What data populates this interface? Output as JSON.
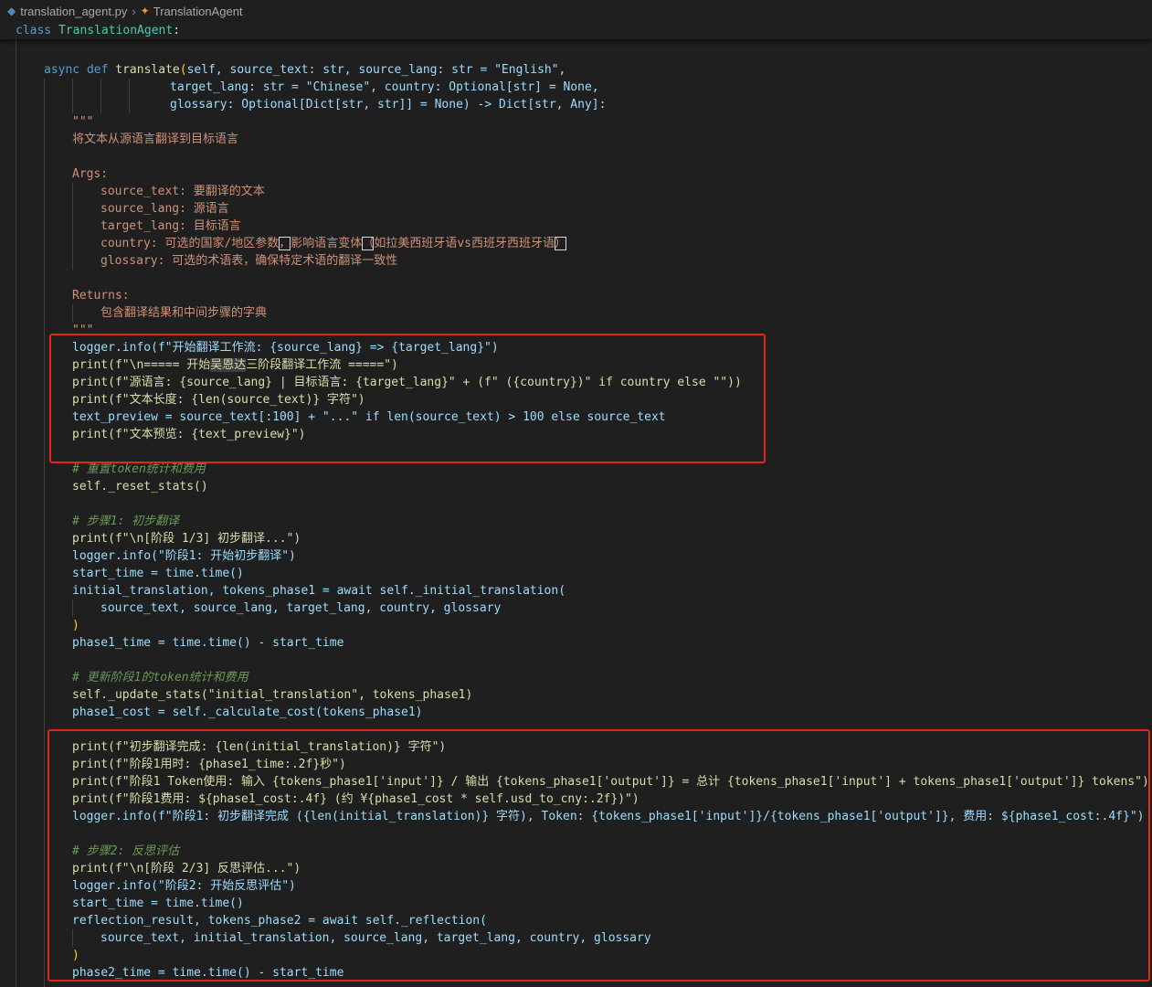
{
  "breadcrumb": {
    "file": "translation_agent.py",
    "symbol": "TranslationAgent"
  },
  "sticky_header": {
    "keyword": "class",
    "name": "TranslationAgent",
    "colon": ":"
  },
  "code": {
    "def_line": {
      "async": "async",
      "def": "def",
      "name": "translate",
      "params1": "self, source_text: str, source_lang: str = \"English\","
    },
    "params2": "target_lang: str = \"Chinese\", country: Optional[str] = None,",
    "params3": "glossary: Optional[Dict[str, str]] = None) -> Dict[str, Any]:",
    "doc_open": "\"\"\"",
    "doc_summary": "将文本从源语言翻译到目标语言",
    "doc_args": "Args:",
    "arg1": "source_text: 要翻译的文本",
    "arg2": "source_lang: 源语言",
    "arg3": "target_lang: 目标语言",
    "arg4_a": "country: 可选的国家/地区参数",
    "arg4_b": "，",
    "arg4_c": "影响语言变体",
    "arg4_d": "（",
    "arg4_e": "如拉美西班牙语vs西班牙西班牙语",
    "arg4_f": "）",
    "arg5": "glossary: 可选的术语表，确保特定术语的翻译一致性",
    "doc_returns": "Returns:",
    "returns_desc": "包含翻译结果和中间步骤的字典",
    "doc_close": "\"\"\"",
    "l_log1": "logger.info(f\"开始翻译工作流: {source_lang} => {target_lang}\")",
    "l_print1_a": "print(f\"\\n===== 开始",
    "l_print1_hl": "吴恩达",
    "l_print1_b": "三阶段翻译工作流 =====\")",
    "l_print2": "print(f\"源语言: {source_lang} | 目标语言: {target_lang}\" + (f\" ({country})\" if country else \"\"))",
    "l_print3": "print(f\"文本长度: {len(source_text)} 字符\")",
    "l_preview": "text_preview = source_text[:100] + \"...\" if len(source_text) > 100 else source_text",
    "l_print4": "print(f\"文本预览: {text_preview}\")",
    "c_reset": "# 重置token统计和费用",
    "l_reset": "self._reset_stats()",
    "c_step1": "# 步骤1: 初步翻译",
    "l_p5": "print(f\"\\n[阶段 1/3] 初步翻译...\")",
    "l_log2": "logger.info(\"阶段1: 开始初步翻译\")",
    "l_st1": "start_time = time.time()",
    "l_init": "initial_translation, tokens_phase1 = await self._initial_translation(",
    "l_init_args": "source_text, source_lang, target_lang, country, glossary",
    "l_close1": ")",
    "l_ph1t": "phase1_time = time.time() - start_time",
    "c_update": "# 更新阶段1的token统计和费用",
    "l_upd": "self._update_stats(\"initial_translation\", tokens_phase1)",
    "l_cost": "phase1_cost = self._calculate_cost(tokens_phase1)",
    "l_p6": "print(f\"初步翻译完成: {len(initial_translation)} 字符\")",
    "l_p7": "print(f\"阶段1用时: {phase1_time:.2f}秒\")",
    "l_p8": "print(f\"阶段1 Token使用: 输入 {tokens_phase1['input']} / 输出 {tokens_phase1['output']} = 总计 {tokens_phase1['input'] + tokens_phase1['output']} tokens\")",
    "l_p9": "print(f\"阶段1费用: ${phase1_cost:.4f} (约 ¥{phase1_cost * self.usd_to_cny:.2f})\")",
    "l_log3": "logger.info(f\"阶段1: 初步翻译完成 ({len(initial_translation)} 字符), Token: {tokens_phase1['input']}/{tokens_phase1['output']}, 费用: ${phase1_cost:.4f}\")",
    "c_step2": "# 步骤2: 反思评估",
    "l_p10": "print(f\"\\n[阶段 2/3] 反思评估...\")",
    "l_log4": "logger.info(\"阶段2: 开始反思评估\")",
    "l_st2": "start_time = time.time()",
    "l_refl": "reflection_result, tokens_phase2 = await self._reflection(",
    "l_refl_args": "source_text, initial_translation, source_lang, target_lang, country, glossary",
    "l_close2": ")",
    "l_ph2t": "phase2_time = time.time() - start_time"
  }
}
